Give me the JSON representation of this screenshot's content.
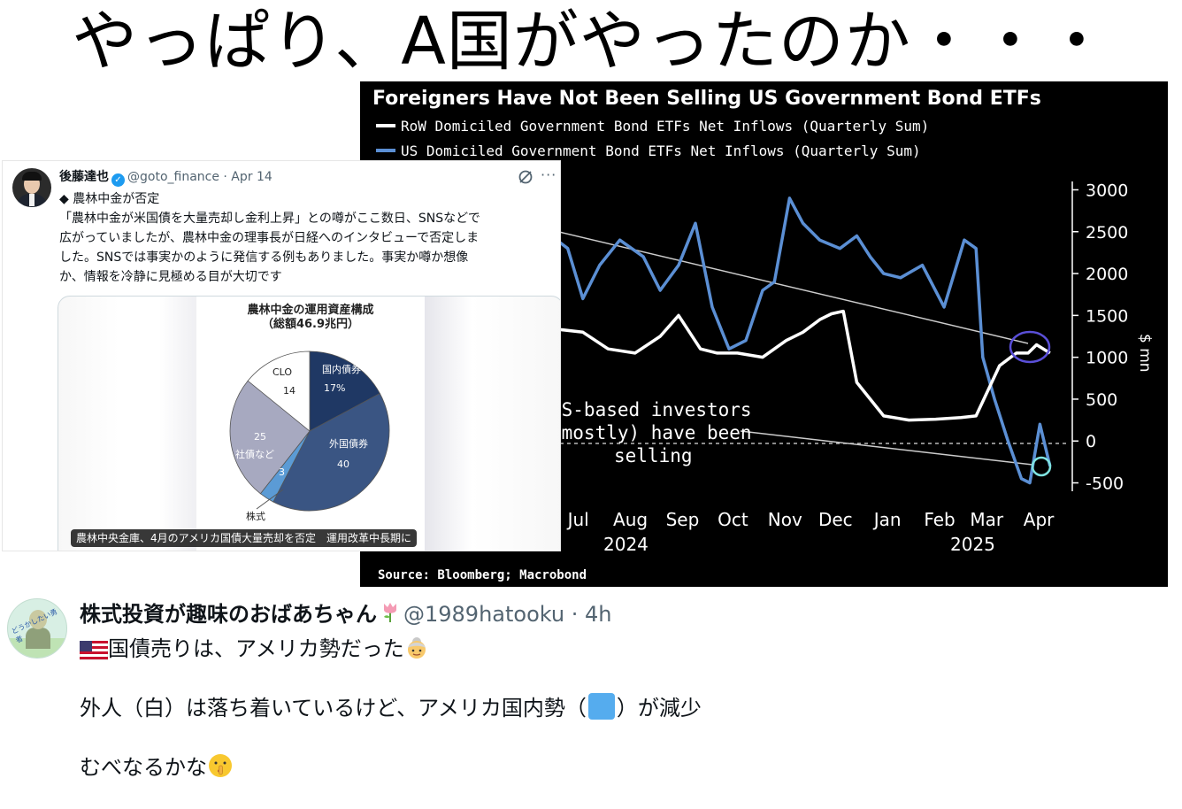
{
  "headline": "やっぱり、A国がやったのか・・・",
  "bloomberg_chart": {
    "title": "Foreigners Have Not Been Selling US Government Bond ETFs",
    "legend": [
      {
        "label": "RoW Domiciled Government Bond ETFs Net Inflows (Quarterly Sum)",
        "color": "#ffffff"
      },
      {
        "label": "US Domiciled Government Bond ETFs Net Inflows (Quarterly Sum)",
        "color": "#5b8fd4"
      }
    ],
    "y_unit_label": "$ mn",
    "y_ticks": [
      "3000",
      "2500",
      "2000",
      "1500",
      "1000",
      "500",
      "0",
      "-500"
    ],
    "x_months": [
      "Jul",
      "Aug",
      "Sep",
      "Oct",
      "Nov",
      "Dec",
      "Jan",
      "Feb",
      "Mar",
      "Apr"
    ],
    "x_years": [
      "2024",
      "2025"
    ],
    "annotation": [
      "US-based investors",
      "(mostly) have been",
      "selling"
    ],
    "source": "Source: Bloomberg; Macrobond"
  },
  "chart_data": {
    "type": "line",
    "title": "Foreigners Have Not Been Selling US Government Bond ETFs",
    "ylabel": "$ mn",
    "ylim": [
      -600,
      3100
    ],
    "x_range": [
      "2024-06-18",
      "2025-04-22"
    ],
    "grid": false,
    "legend_position": "top-left",
    "series": [
      {
        "name": "RoW Domiciled Government Bond ETFs Net Inflows (Quarterly Sum)",
        "color": "#ffffff",
        "x": [
          "2024-06-18",
          "2024-07-10",
          "2024-07-25",
          "2024-08-10",
          "2024-08-25",
          "2024-09-05",
          "2024-09-18",
          "2024-09-28",
          "2024-10-10",
          "2024-10-25",
          "2024-11-08",
          "2024-11-18",
          "2024-11-28",
          "2024-12-05",
          "2024-12-12",
          "2024-12-20",
          "2025-01-05",
          "2025-01-20",
          "2025-02-05",
          "2025-02-20",
          "2025-03-01",
          "2025-03-08",
          "2025-03-15",
          "2025-03-25",
          "2025-04-01",
          "2025-04-06",
          "2025-04-14"
        ],
        "values": [
          1350,
          1300,
          1100,
          1050,
          1250,
          1500,
          1100,
          1050,
          1050,
          1000,
          1200,
          1300,
          1450,
          1520,
          1550,
          700,
          300,
          250,
          260,
          280,
          300,
          600,
          900,
          1050,
          1050,
          1150,
          1050
        ]
      },
      {
        "name": "US Domiciled Government Bond ETFs Net Inflows (Quarterly Sum)",
        "color": "#5b8fd4",
        "x": [
          "2024-06-18",
          "2024-07-01",
          "2024-07-10",
          "2024-07-20",
          "2024-08-01",
          "2024-08-15",
          "2024-08-25",
          "2024-09-05",
          "2024-09-15",
          "2024-09-25",
          "2024-10-05",
          "2024-10-15",
          "2024-10-25",
          "2024-11-01",
          "2024-11-10",
          "2024-11-18",
          "2024-11-28",
          "2024-12-10",
          "2024-12-20",
          "2024-12-28",
          "2025-01-05",
          "2025-01-15",
          "2025-01-28",
          "2025-02-10",
          "2025-02-22",
          "2025-03-01",
          "2025-03-05",
          "2025-03-12",
          "2025-03-20",
          "2025-03-28",
          "2025-04-02",
          "2025-04-08",
          "2025-04-14"
        ],
        "values": [
          2500,
          2300,
          1700,
          2100,
          2400,
          2200,
          1800,
          2100,
          2600,
          1600,
          1100,
          1200,
          1800,
          1900,
          2900,
          2600,
          2400,
          2300,
          2450,
          2200,
          2000,
          1950,
          2100,
          1600,
          2400,
          2300,
          1000,
          500,
          0,
          -450,
          -500,
          200,
          -300
        ]
      }
    ],
    "annotations": [
      {
        "text": [
          "US-based investors",
          "(mostly) have been",
          "selling"
        ]
      }
    ]
  },
  "tweet1": {
    "name": "後藤達也",
    "handle": "@goto_finance · Apr 14",
    "more": "···",
    "lines": [
      "◆ 農林中金が否定",
      "「農林中金が米国債を大量売却し金利上昇」との噂がここ数日、SNSなどで",
      "広がっていましたが、農林中金の理事長が日経へのインタビューで否定しま",
      "した。SNSでは事実かのように発信する例もありました。事実か噂か想像",
      "か、情報を冷静に見極める目が大切です"
    ],
    "card_caption": "農林中央金庫、4月のアメリカ国債大量売却を否定　運用改革中長期に",
    "pie": {
      "title_line1": "農林中金の運用資産構成",
      "title_line2": "（総額46.9兆円）",
      "slices": [
        {
          "label": "国内債券",
          "value": 17,
          "value_label": "17%",
          "color": "#1f3864"
        },
        {
          "label": "外国債券",
          "value": 40,
          "value_label": "40",
          "color": "#3a5583"
        },
        {
          "label": "株式",
          "value": 3,
          "value_label": "3",
          "color": "#5b9bd5"
        },
        {
          "label": "社債など",
          "value": 25,
          "value_label": "25",
          "color": "#a7a9c0"
        },
        {
          "label": "CLO",
          "value": 14,
          "value_label": "14",
          "color": "#ffffff"
        }
      ]
    }
  },
  "tweet2": {
    "name": "株式投資が趣味のおばあちゃん",
    "handle": "@1989hatooku · 4h",
    "avatar_text": "どうかしたい勇者",
    "line1": "国債売りは、アメリカ勢だった",
    "line2a": "外人（白）は落ち着いているけど、アメリカ国内勢（",
    "line2b": "）が減少",
    "line3": "むべなるかな",
    "blue_square_color": "#55acee"
  }
}
